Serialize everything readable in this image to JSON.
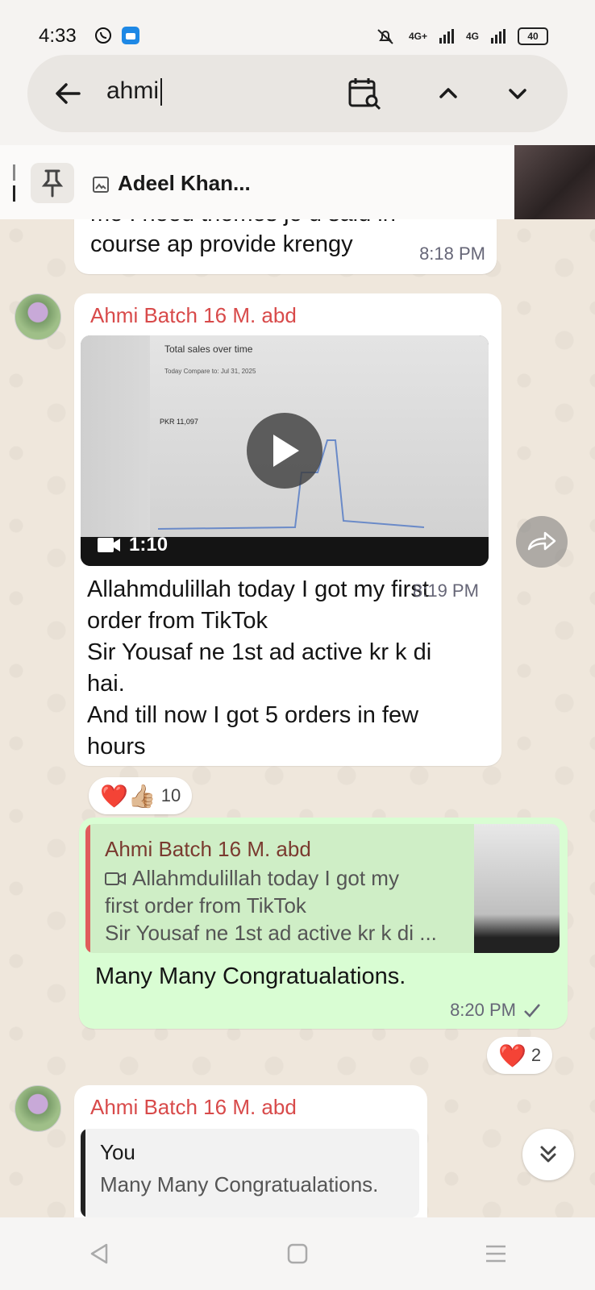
{
  "status_bar": {
    "time": "4:33",
    "signal_1": "4G+",
    "signal_2": "4G",
    "battery": "40"
  },
  "search": {
    "query": "ahmi"
  },
  "pinned": {
    "name": "Adeel Khan..."
  },
  "messages": [
    {
      "type": "incoming_text_partial",
      "lines": [
        "me I need themes jo u said in",
        "course ap provide krengy"
      ],
      "time": "8:18 PM"
    },
    {
      "type": "incoming_video",
      "sender": "Ahmi Batch 16 M. abd",
      "video_duration": "1:10",
      "video_screen": {
        "title": "Total sales over time",
        "subtitle": "Today    Compare to: Jul 31, 2025",
        "value": "PKR 11,097"
      },
      "lines": [
        "Allahmdulillah today I got my first",
        "order from TikTok",
        "Sir Yousaf ne 1st ad active kr k di",
        "hai.",
        "And till now I got 5 orders in few",
        "hours"
      ],
      "time": "8:19 PM",
      "reactions": {
        "emojis": "❤️👍🏼",
        "count": "10"
      }
    },
    {
      "type": "outgoing_reply",
      "quote_sender": "Ahmi Batch 16 M. abd",
      "quote_lines": [
        "Allahmdulillah today I got my",
        "first order from TikTok",
        "Sir Yousaf ne 1st ad active kr k di ..."
      ],
      "text": "Many Many Congratualations.",
      "time": "8:20 PM",
      "reactions": {
        "emojis": "❤️",
        "count": "2"
      }
    },
    {
      "type": "incoming_reply_partial",
      "sender": "Ahmi Batch 16 M. abd",
      "quote_sender": "You",
      "quote_text": "Many Many Congratualations."
    }
  ],
  "colors": {
    "sender_name": "#d84a4a",
    "outgoing_bubble": "#d9fdd3",
    "chat_background": "#efe7dc"
  }
}
